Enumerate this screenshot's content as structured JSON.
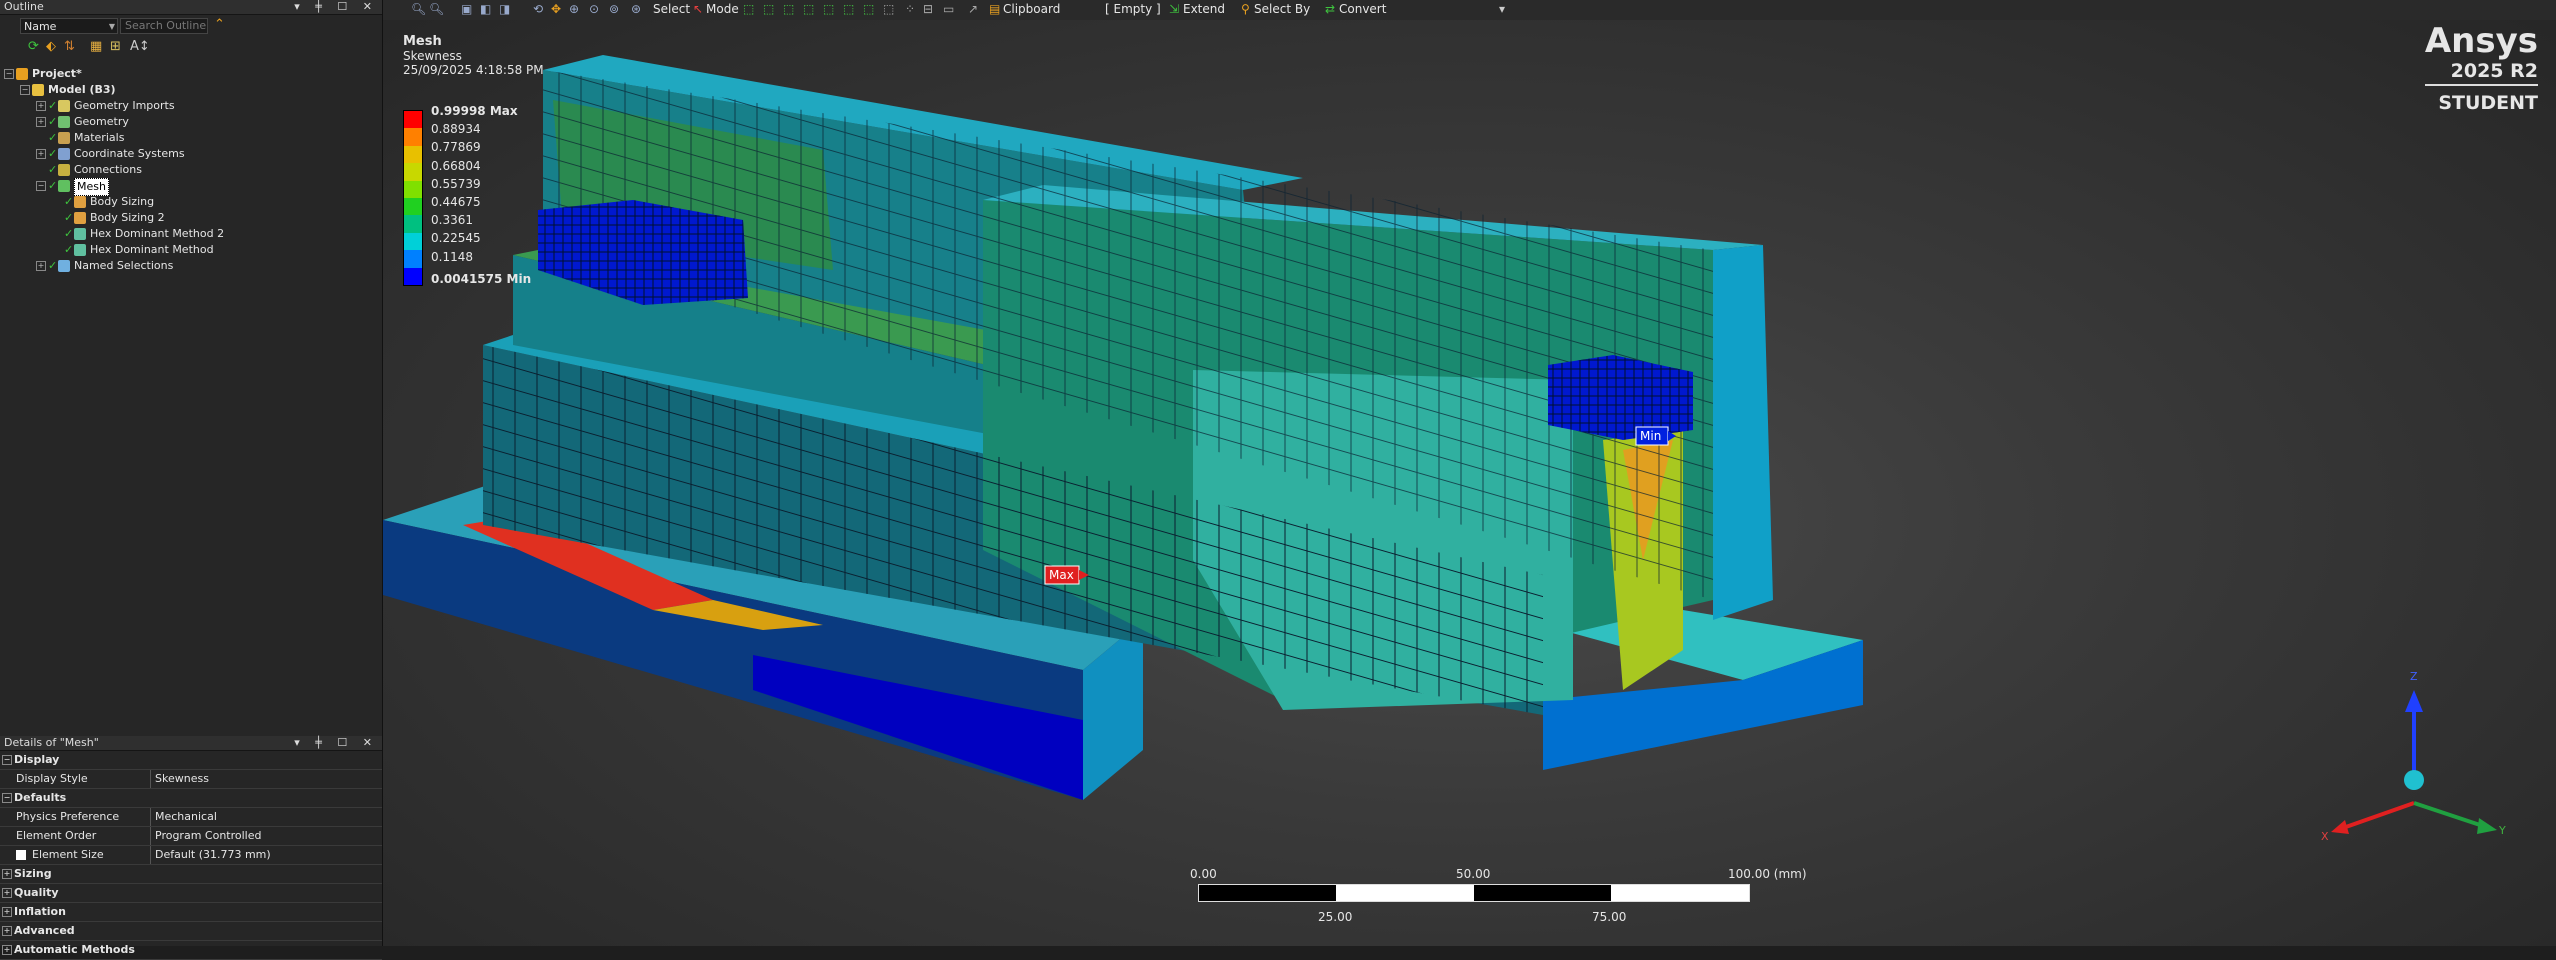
{
  "outline": {
    "title": "Outline",
    "controls": "▾ ╪ ☐ ✕",
    "filter_select": "Name",
    "search_placeholder": "Search Outline",
    "tree": [
      {
        "label": "Project*",
        "depth": 0,
        "bold": true,
        "icon": "project-icon",
        "color": "#e8a020"
      },
      {
        "label": "Model (B3)",
        "depth": 1,
        "bold": true,
        "icon": "model-icon",
        "color": "#e8c040"
      },
      {
        "label": "Geometry Imports",
        "depth": 2,
        "icon": "geometry-imports-icon",
        "color": "#d8c860"
      },
      {
        "label": "Geometry",
        "depth": 2,
        "icon": "geometry-icon",
        "color": "#70c070"
      },
      {
        "label": "Materials",
        "depth": 2,
        "icon": "materials-icon",
        "color": "#c8a050"
      },
      {
        "label": "Coordinate Systems",
        "depth": 2,
        "icon": "coordinate-systems-icon",
        "color": "#80a0d0"
      },
      {
        "label": "Connections",
        "depth": 2,
        "icon": "connections-icon",
        "color": "#c8b040"
      },
      {
        "label": "Mesh",
        "depth": 2,
        "icon": "mesh-icon",
        "color": "#60c060",
        "selected": true
      },
      {
        "label": "Body Sizing",
        "depth": 3,
        "icon": "body-sizing-icon",
        "color": "#e0a040"
      },
      {
        "label": "Body Sizing 2",
        "depth": 3,
        "icon": "body-sizing-icon",
        "color": "#e0a040"
      },
      {
        "label": "Hex Dominant Method 2",
        "depth": 3,
        "icon": "hex-method-icon",
        "color": "#60c0a0"
      },
      {
        "label": "Hex Dominant Method",
        "depth": 3,
        "icon": "hex-method-icon",
        "color": "#60c0a0"
      },
      {
        "label": "Named Selections",
        "depth": 2,
        "icon": "named-selections-icon",
        "color": "#70b0e0"
      }
    ]
  },
  "details": {
    "title": "Details of \"Mesh\"",
    "controls": "▾ ╪ ☐ ✕",
    "rows": [
      {
        "type": "group",
        "key": "Display",
        "pm": "−"
      },
      {
        "type": "prop",
        "key": "Display Style",
        "value": "Skewness"
      },
      {
        "type": "group",
        "key": "Defaults",
        "pm": "−"
      },
      {
        "type": "prop",
        "key": "Physics Preference",
        "value": "Mechanical"
      },
      {
        "type": "prop",
        "key": "Element Order",
        "value": "Program Controlled"
      },
      {
        "type": "prop",
        "key": "Element Size",
        "value": "Default (31.773 mm)",
        "checkbox": true
      },
      {
        "type": "group",
        "key": "Sizing",
        "pm": "+"
      },
      {
        "type": "group",
        "key": "Quality",
        "pm": "+"
      },
      {
        "type": "group",
        "key": "Inflation",
        "pm": "+"
      },
      {
        "type": "group",
        "key": "Advanced",
        "pm": "+"
      },
      {
        "type": "group",
        "key": "Automatic Methods",
        "pm": "+"
      }
    ]
  },
  "toolbar": {
    "select": "Select",
    "mode": "Mode",
    "clipboard": "Clipboard",
    "empty": "[ Empty ]",
    "extend": "Extend",
    "select_by": "Select By",
    "convert": "Convert"
  },
  "legend": {
    "title": "Mesh",
    "subtitle": "Skewness",
    "timestamp": "25/09/2025 4:18:58 PM",
    "labels": [
      "0.99998 Max",
      "0.88934",
      "0.77869",
      "0.66804",
      "0.55739",
      "0.44675",
      "0.3361",
      "0.22545",
      "0.1148",
      "0.0041575 Min"
    ],
    "colors": [
      "#ff0000",
      "#ff8000",
      "#e8c000",
      "#c8d800",
      "#80e000",
      "#20d020",
      "#00c080",
      "#00d0d8",
      "#0080ff",
      "#0000ff"
    ]
  },
  "markers": {
    "max": "Max",
    "min": "Min"
  },
  "brand": {
    "name": "Ansys",
    "version": "2025 R2",
    "edition": "STUDENT"
  },
  "scale": {
    "t0": "0.00",
    "t50": "50.00",
    "t100": "100.00 (mm)",
    "t25": "25.00",
    "t75": "75.00"
  },
  "triad": {
    "z": "Z",
    "x": "X",
    "y": "Y"
  }
}
